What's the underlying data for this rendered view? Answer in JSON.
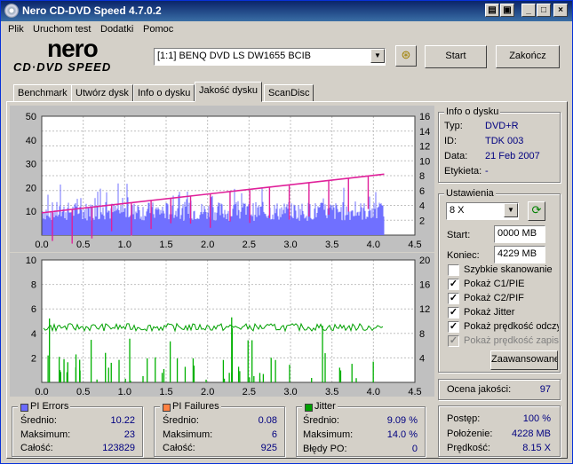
{
  "window": {
    "title": "Nero CD-DVD Speed 4.7.0.2"
  },
  "menu": [
    "Plik",
    "Uruchom test",
    "Dodatki",
    "Pomoc"
  ],
  "logo": {
    "top": "nero",
    "bottom": "CD·DVD SPEED"
  },
  "toolbar": {
    "drive": "[1:1]  BENQ DVD LS DW1655 BCIB",
    "start": "Start",
    "quit": "Zakończ"
  },
  "tabs": [
    "Benchmark",
    "Utwórz dysk",
    "Info o dysku",
    "Jakość dysku",
    "ScanDisc"
  ],
  "disc_info": {
    "group": "Info o dysku",
    "type_label": "Typ:",
    "type": "DVD+R",
    "id_label": "ID:",
    "id": "TDK 003",
    "date_label": "Data:",
    "date": "21 Feb 2007",
    "tag_label": "Etykieta:",
    "tag": "-"
  },
  "settings": {
    "group": "Ustawienia",
    "speed": "8 X",
    "start_label": "Start:",
    "start": "0000 MB",
    "end_label": "Koniec:",
    "end": "4229 MB",
    "checks": [
      {
        "label": "Szybkie skanowanie",
        "checked": false,
        "enabled": true
      },
      {
        "label": "Pokaż C1/PIE",
        "checked": true,
        "enabled": true
      },
      {
        "label": "Pokaż C2/PIF",
        "checked": true,
        "enabled": true
      },
      {
        "label": "Pokaż Jitter",
        "checked": true,
        "enabled": true
      },
      {
        "label": "Pokaż prędkość odczytu",
        "checked": true,
        "enabled": true
      },
      {
        "label": "Pokaż prędkość zapisu",
        "checked": true,
        "enabled": false
      }
    ],
    "advanced": "Zaawansowane"
  },
  "quality": {
    "label": "Ocena jakości:",
    "value": "97"
  },
  "progress": {
    "pos_label": "Postęp:",
    "pos": "100 %",
    "loc_label": "Położenie:",
    "loc": "4228 MB",
    "speed_label": "Prędkość:",
    "speed": "8.15 X"
  },
  "pi_errors": {
    "title": "PI Errors",
    "color": "#6a6aff",
    "avg_label": "Średnio:",
    "avg": "10.22",
    "max_label": "Maksimum:",
    "max": "23",
    "total_label": "Całość:",
    "total": "123829"
  },
  "pi_failures": {
    "title": "PI Failures",
    "color": "#ff8040",
    "avg_label": "Średnio:",
    "avg": "0.08",
    "max_label": "Maksimum:",
    "max": "6",
    "total_label": "Całość:",
    "total": "925"
  },
  "jitter": {
    "title": "Jitter",
    "color": "#00a000",
    "avg_label": "Średnio:",
    "avg": "9.09 %",
    "max_label": "Maksimum:",
    "max": "14.0 %",
    "po_label": "Błędy PO:",
    "po": "0"
  },
  "chart_data": [
    {
      "type": "bar",
      "name": "PI Errors / read speed",
      "x_ticks": [
        "0.0",
        "0.5",
        "1.0",
        "1.5",
        "2.0",
        "2.5",
        "3.0",
        "3.5",
        "4.0",
        "4.5"
      ],
      "y_ticks_left": [
        "50",
        "40",
        "30",
        "20",
        "10"
      ],
      "y_ticks_right": [
        "16",
        "14",
        "12",
        "10",
        "8",
        "6",
        "4",
        "2"
      ],
      "xlim": [
        0,
        4.5
      ],
      "ylim_left": [
        0,
        50
      ],
      "ylim_right": [
        0,
        16
      ],
      "series": [
        {
          "name": "PI Errors",
          "color": "#7070ff",
          "typical": 10,
          "max": 23,
          "x_end": 4.13
        },
        {
          "name": "Read speed",
          "color": "#e0209a",
          "x": [
            0,
            4.13
          ],
          "y": [
            3.0,
            8.2
          ]
        }
      ]
    },
    {
      "type": "bar",
      "name": "PI Failures / jitter",
      "x_ticks": [
        "0.0",
        "0.5",
        "1.0",
        "1.5",
        "2.0",
        "2.5",
        "3.0",
        "3.5",
        "4.0",
        "4.5"
      ],
      "y_ticks_left": [
        "10",
        "8",
        "6",
        "4",
        "2"
      ],
      "y_ticks_right": [
        "20",
        "16",
        "12",
        "8",
        "4"
      ],
      "xlim": [
        0,
        4.5
      ],
      "ylim_left": [
        0,
        10
      ],
      "ylim_right": [
        0,
        20
      ],
      "series": [
        {
          "name": "PI Failures",
          "color": "#00b000",
          "max": 6
        },
        {
          "name": "Jitter",
          "color": "#00a000",
          "mean": 9.09,
          "max": 14.0
        }
      ]
    }
  ],
  "colors": {
    "accent": "#0a246a",
    "value": "#000080",
    "bg": "#d4d0c8"
  }
}
